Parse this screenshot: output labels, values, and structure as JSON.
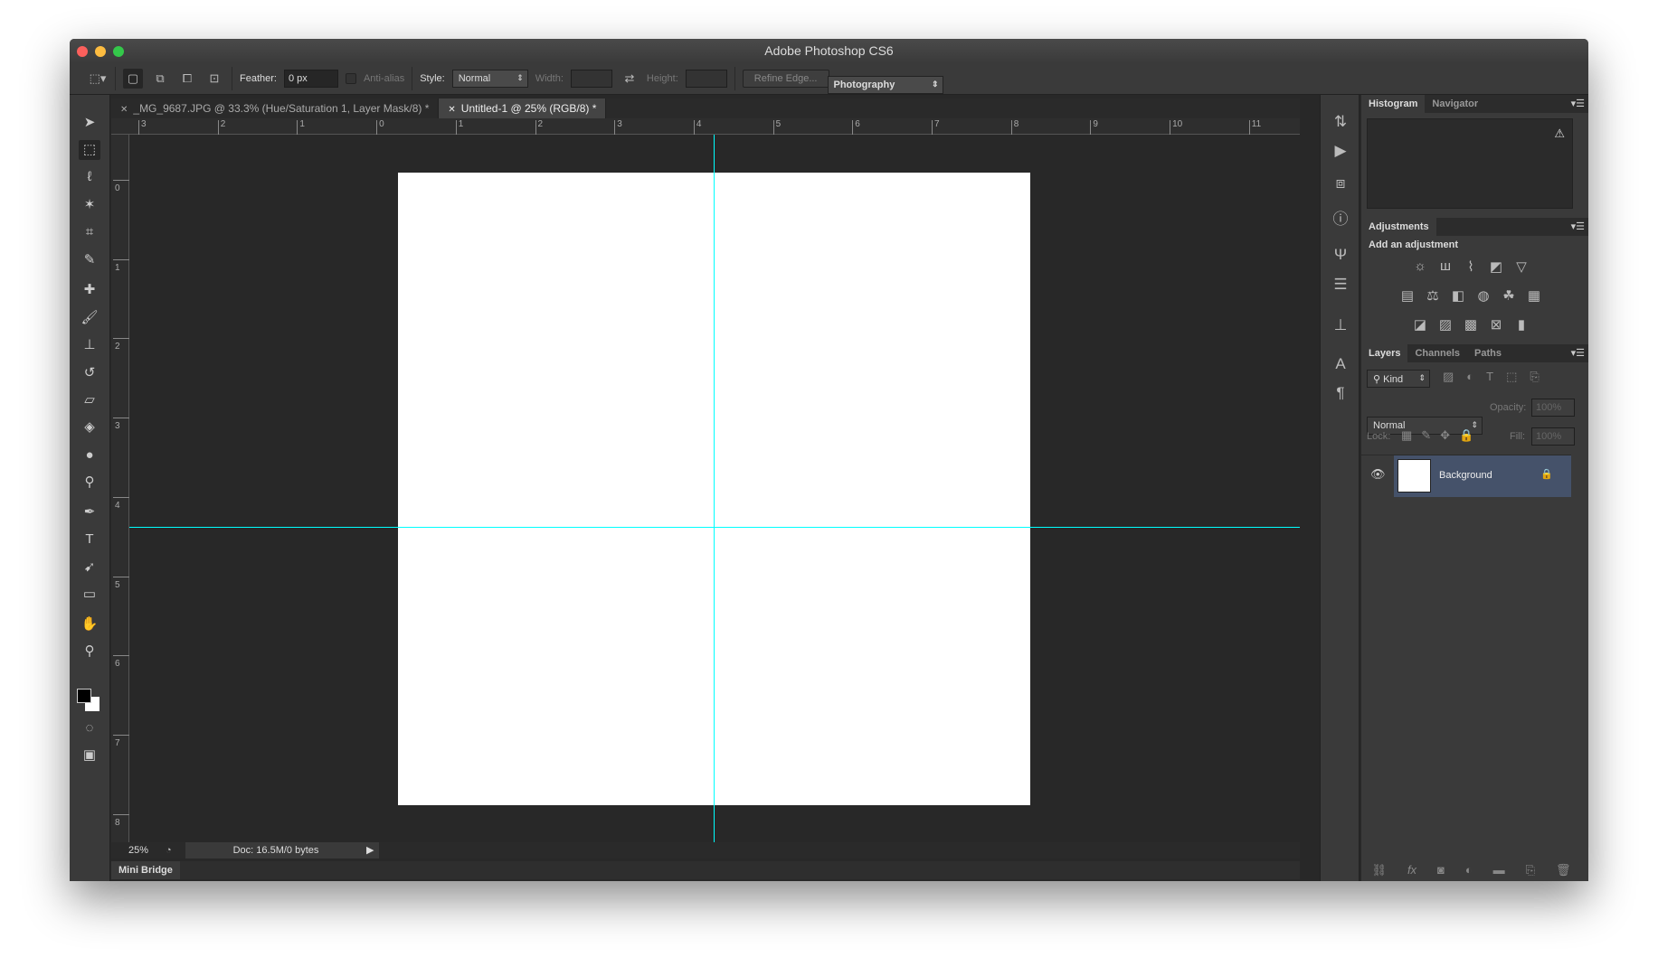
{
  "window": {
    "title": "Adobe Photoshop CS6"
  },
  "options_bar": {
    "feather_label": "Feather:",
    "feather_value": "0 px",
    "antialias_label": "Anti-alias",
    "style_label": "Style:",
    "style_value": "Normal",
    "width_label": "Width:",
    "height_label": "Height:",
    "refine_edge": "Refine Edge...",
    "workspace": "Photography"
  },
  "tabs": [
    {
      "label": "_MG_9687.JPG @ 33.3% (Hue/Saturation 1, Layer Mask/8) *",
      "active": false
    },
    {
      "label": "Untitled-1 @ 25% (RGB/8) *",
      "active": true
    }
  ],
  "rulers": {
    "horizontal": [
      "3",
      "2",
      "1",
      "0",
      "1",
      "2",
      "3",
      "4",
      "5",
      "6",
      "7",
      "8",
      "9",
      "10",
      "11"
    ],
    "vertical": [
      "0",
      "1",
      "2",
      "3",
      "4",
      "5",
      "6",
      "7",
      "8"
    ]
  },
  "guide_color": "#00ffff",
  "status": {
    "zoom": "25%",
    "doc": "Doc: 16.5M/0 bytes"
  },
  "mini_bridge": "Mini Bridge",
  "panels": {
    "histogram_tabs": [
      "Histogram",
      "Navigator"
    ],
    "adjustments_tab": "Adjustments",
    "add_adjustment": "Add an adjustment",
    "layers_tabs": [
      "Layers",
      "Channels",
      "Paths"
    ],
    "filter_kind": "Kind",
    "blend_mode": "Normal",
    "opacity_label": "Opacity:",
    "opacity_value": "100%",
    "lock_label": "Lock:",
    "fill_label": "Fill:",
    "fill_value": "100%",
    "layers": [
      {
        "name": "Background",
        "locked": true,
        "visible": true
      }
    ]
  }
}
